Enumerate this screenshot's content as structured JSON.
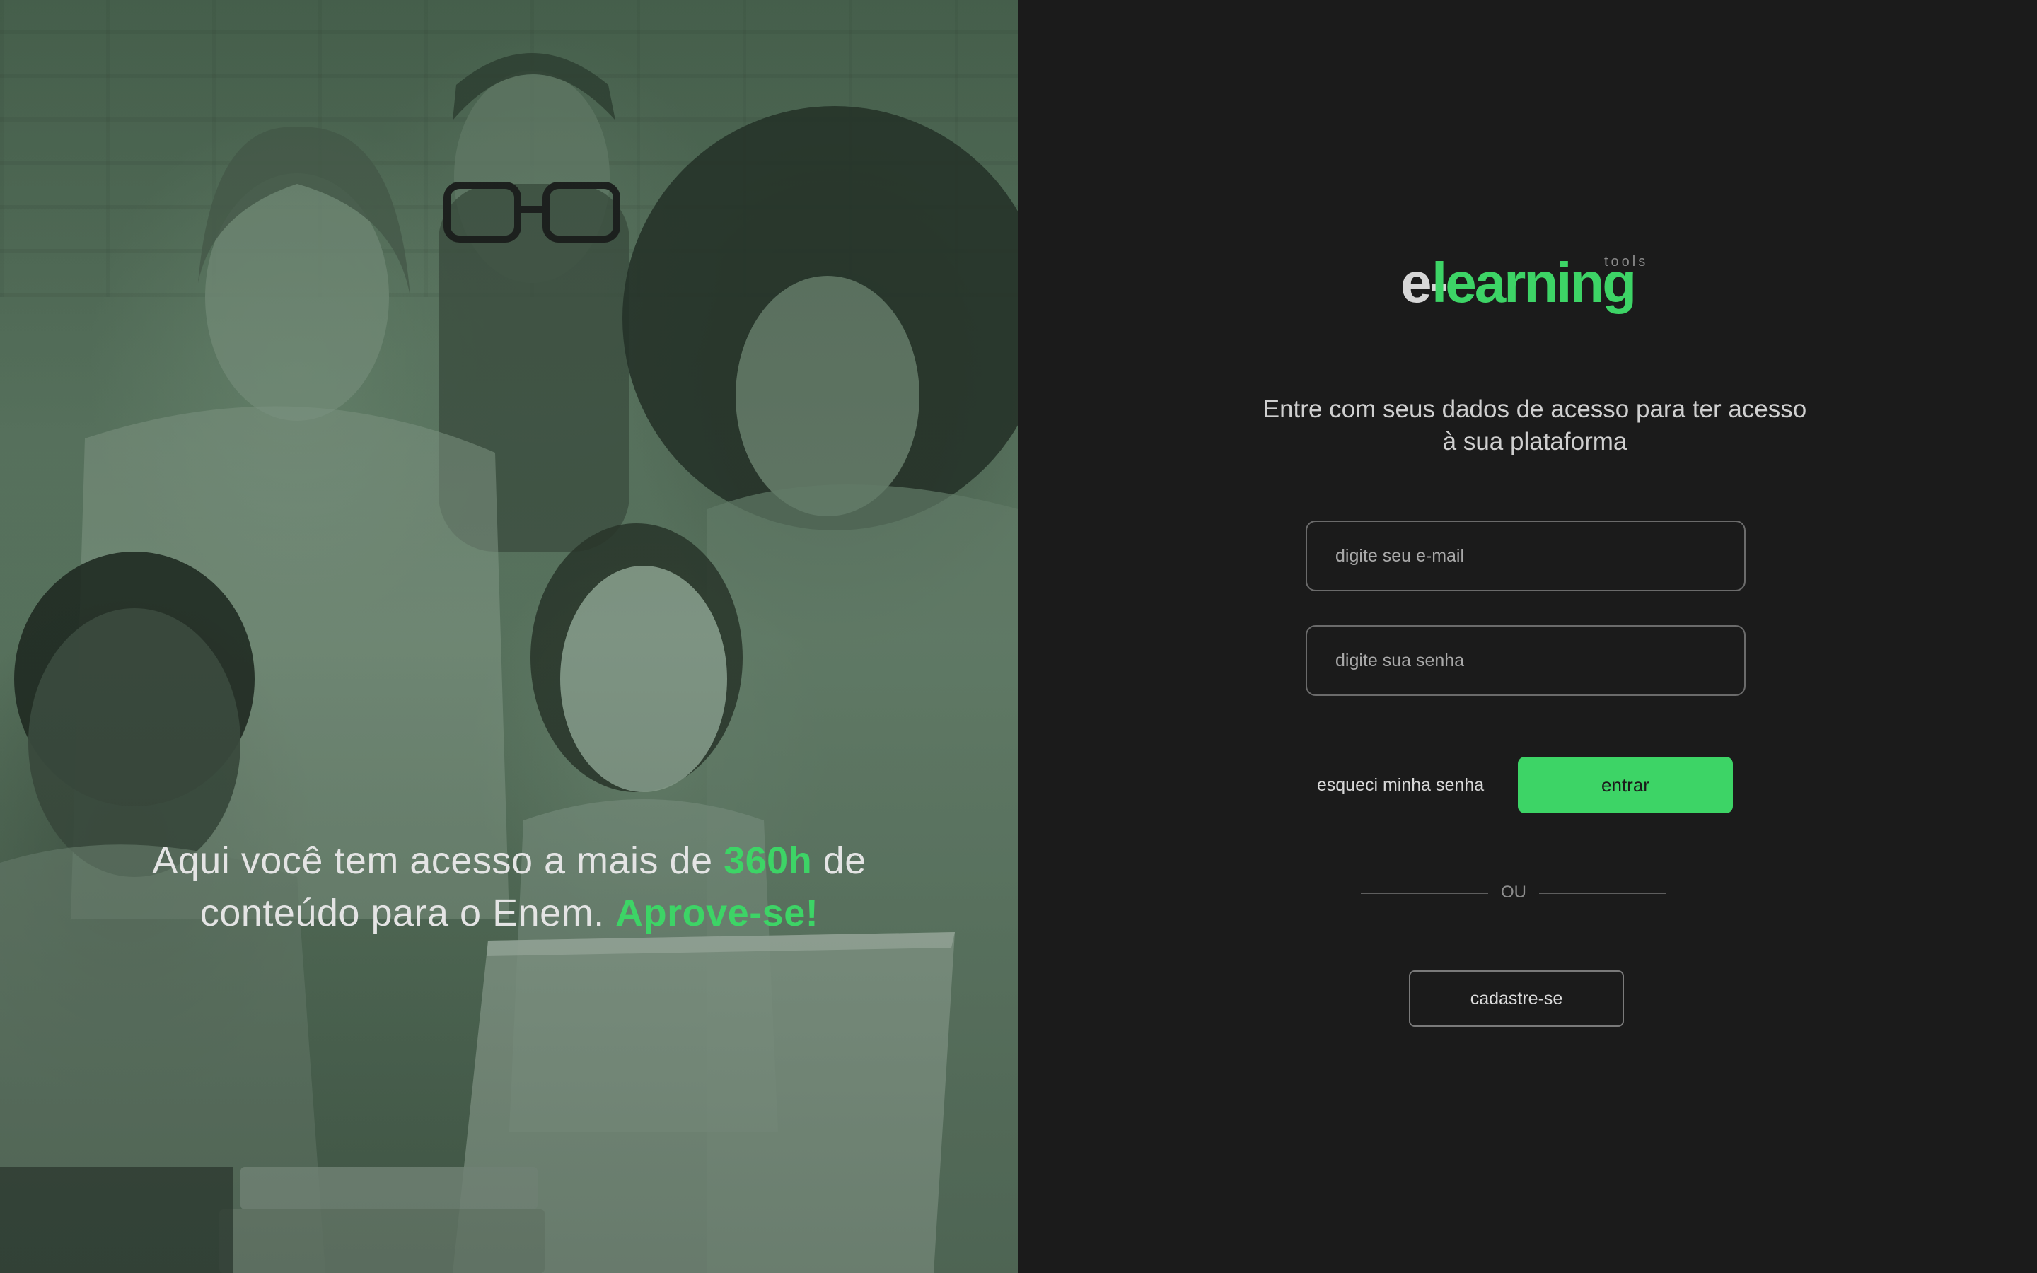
{
  "hero": {
    "text_part1": "Aqui você tem acesso a mais de ",
    "highlight_hours": "360h",
    "text_part2": " de",
    "text_part3": "conteúdo para o Enem. ",
    "highlight_cta": "Aprove-se!"
  },
  "logo": {
    "prefix": "e-",
    "main": "learning",
    "suffix": "tools"
  },
  "intro": {
    "line1": "Entre com seus dados de acesso para ter acesso",
    "line2": "à sua plataforma"
  },
  "form": {
    "email_placeholder": "digite seu e-mail",
    "password_placeholder": "digite sua senha",
    "forgot_label": "esqueci minha senha",
    "enter_label": "entrar",
    "divider_label": "OU",
    "signup_label": "cadastre-se"
  },
  "colors": {
    "accent": "#3dd466",
    "background": "#1b1b1b",
    "hero_tint": "#56705b"
  }
}
